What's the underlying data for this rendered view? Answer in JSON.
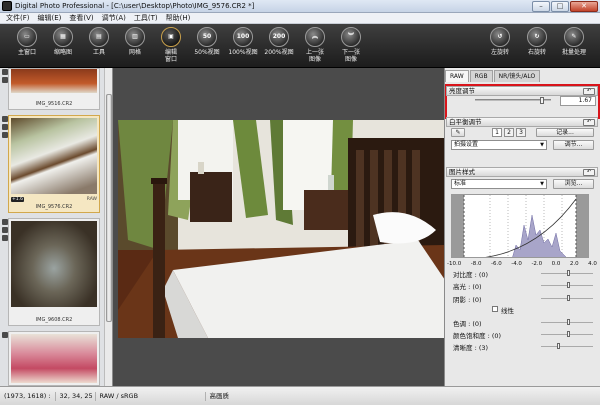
{
  "window": {
    "title": "Digital Photo Professional - [C:\\user\\Desktop\\Photo\\IMG_9576.CR2 *]",
    "min": "–",
    "max": "□",
    "close": "✕"
  },
  "menu": [
    "文件(F)",
    "编辑(E)",
    "查看(V)",
    "调节(A)",
    "工具(T)",
    "帮助(H)"
  ],
  "toolbar": [
    {
      "icon": "folder-icon",
      "glyph": "▭",
      "label": "主窗口"
    },
    {
      "icon": "thumbnail-icon",
      "glyph": "▦",
      "label": "缩略图"
    },
    {
      "icon": "tool-icon",
      "glyph": "▤",
      "label": "工具"
    },
    {
      "icon": "grid-icon",
      "glyph": "▥",
      "label": "网格"
    },
    {
      "icon": "edit-window-icon",
      "glyph": "▣",
      "label": "编辑\n窗口"
    },
    {
      "icon": "zoom-50-icon",
      "glyph": "50",
      "label": "50%视图"
    },
    {
      "icon": "zoom-100-icon",
      "glyph": "100",
      "label": "100%视图"
    },
    {
      "icon": "zoom-200-icon",
      "glyph": "200",
      "label": "200%视图"
    },
    {
      "icon": "previous-image-icon",
      "glyph": "︽",
      "label": "上一张\n图像"
    },
    {
      "icon": "next-image-icon",
      "glyph": "︾",
      "label": "下一张\n图像"
    },
    {
      "icon": "rotate-left-icon",
      "glyph": "↺",
      "label": "左旋转"
    },
    {
      "icon": "rotate-right-icon",
      "glyph": "↻",
      "label": "右旋转"
    },
    {
      "icon": "batch-process-icon",
      "glyph": "✎",
      "label": "批量处理"
    }
  ],
  "thumbnails": [
    {
      "name": "IMG_9516.CR2",
      "badge": "",
      "raw": ""
    },
    {
      "name": "IMG_9576.CR2",
      "badge": "+1.6",
      "raw": "RAW"
    },
    {
      "name": "IMG_9608.CR2",
      "badge": "",
      "raw": ""
    },
    {
      "name": "",
      "badge": "",
      "raw": ""
    }
  ],
  "right": {
    "tabs": [
      "RAW",
      "RGB",
      "NR/镜头/ALO"
    ],
    "brightness": {
      "title": "亮度调节",
      "value": "1.67",
      "level": 0.9
    },
    "wb": {
      "title": "白平衡调节",
      "n1": "1",
      "n2": "2",
      "n3": "3",
      "record": "记录...",
      "select": "拍摄设置",
      "adjust": "调节..."
    },
    "style": {
      "title": "图片样式",
      "select": "标准",
      "browse": "浏览..."
    },
    "hist_labels": [
      "-10.0",
      "-8.0",
      "-6.0",
      "-4.0",
      "-2.0",
      "0.0",
      "2.0",
      "4.0"
    ],
    "rows": {
      "contrast": "对比度 : (0)",
      "highlight": "高光 : (0)",
      "shadow": "阴影 : (0)",
      "linear": "线性",
      "tone": "色调 : (0)",
      "saturation": "颜色饱和度 : (0)",
      "sharpness": "清晰度 : (3)"
    }
  },
  "status": {
    "coords": "(1973, 1618) :",
    "values": "32, 34, 25",
    "space": "RAW / sRGB",
    "quality": "高画质"
  }
}
